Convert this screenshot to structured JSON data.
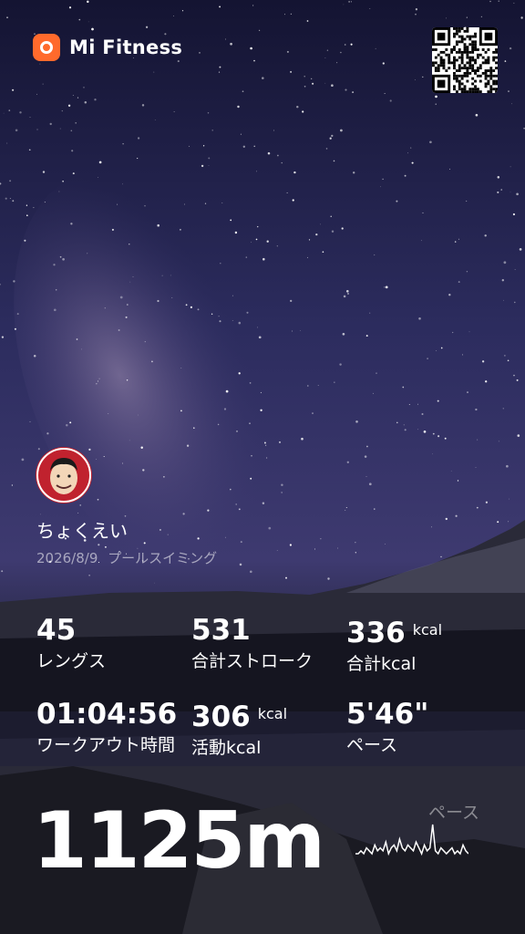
{
  "brand": {
    "name": "Mi Fitness",
    "accent": "#ff6a2c"
  },
  "user": {
    "name": "ちょくえい",
    "date": "2026/8/9",
    "activity": "プールスイミング"
  },
  "stats": [
    {
      "value": "45",
      "unit": "",
      "label": "レングス"
    },
    {
      "value": "531",
      "unit": "",
      "label": "合計ストローク"
    },
    {
      "value": "336",
      "unit": "kcal",
      "label": "合計kcal"
    },
    {
      "value": "01:04:56",
      "unit": "",
      "label": "ワークアウト時間"
    },
    {
      "value": "306",
      "unit": "kcal",
      "label": "活動kcal"
    },
    {
      "value": "5'46\"",
      "unit": "",
      "label": "ペース"
    }
  ],
  "distance": "1125m",
  "pace_chart": {
    "label": "ペース",
    "values": [
      0,
      0,
      1,
      0,
      2,
      1,
      0,
      3,
      1,
      2,
      1,
      4,
      0,
      2,
      3,
      1,
      5,
      2,
      1,
      3,
      2,
      1,
      4,
      2,
      0,
      3,
      1,
      2,
      10,
      1,
      0,
      2,
      1,
      0,
      1,
      2,
      0,
      1,
      0,
      3,
      1,
      0
    ]
  }
}
